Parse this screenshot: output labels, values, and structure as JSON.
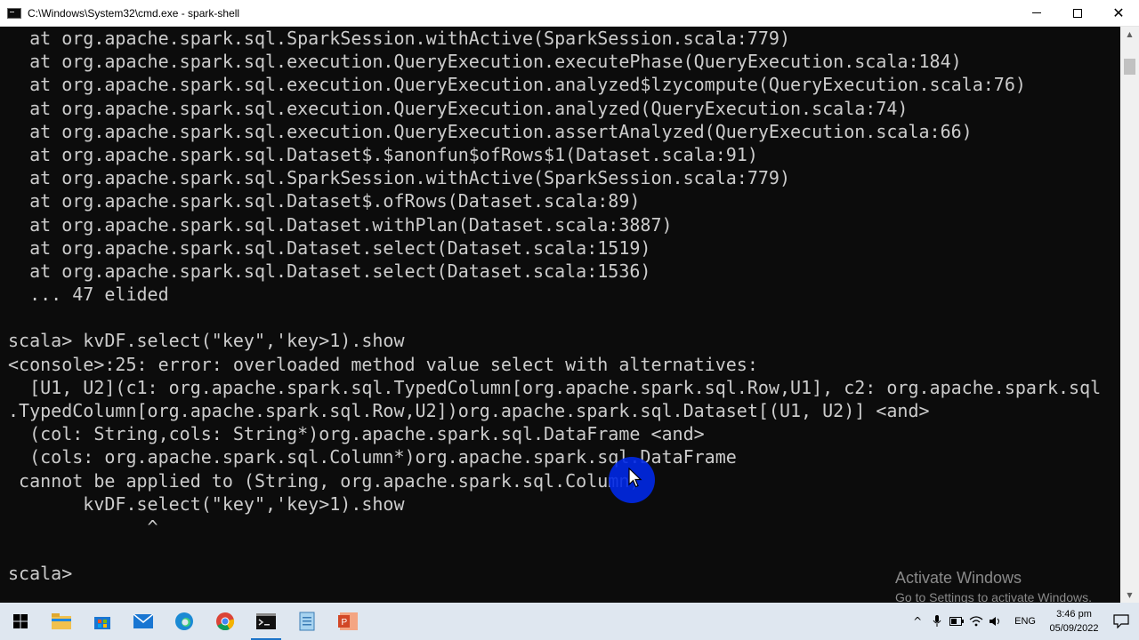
{
  "window": {
    "title": "C:\\Windows\\System32\\cmd.exe - spark-shell",
    "minimize_label": "",
    "maximize_label": "",
    "close_label": "✕"
  },
  "console": {
    "lines": [
      "  at org.apache.spark.sql.SparkSession.withActive(SparkSession.scala:779)",
      "  at org.apache.spark.sql.execution.QueryExecution.executePhase(QueryExecution.scala:184)",
      "  at org.apache.spark.sql.execution.QueryExecution.analyzed$lzycompute(QueryExecution.scala:76)",
      "  at org.apache.spark.sql.execution.QueryExecution.analyzed(QueryExecution.scala:74)",
      "  at org.apache.spark.sql.execution.QueryExecution.assertAnalyzed(QueryExecution.scala:66)",
      "  at org.apache.spark.sql.Dataset$.$anonfun$ofRows$1(Dataset.scala:91)",
      "  at org.apache.spark.sql.SparkSession.withActive(SparkSession.scala:779)",
      "  at org.apache.spark.sql.Dataset$.ofRows(Dataset.scala:89)",
      "  at org.apache.spark.sql.Dataset.withPlan(Dataset.scala:3887)",
      "  at org.apache.spark.sql.Dataset.select(Dataset.scala:1519)",
      "  at org.apache.spark.sql.Dataset.select(Dataset.scala:1536)",
      "  ... 47 elided",
      "",
      "scala> kvDF.select(\"key\",'key>1).show",
      "<console>:25: error: overloaded method value select with alternatives:",
      "  [U1, U2](c1: org.apache.spark.sql.TypedColumn[org.apache.spark.sql.Row,U1], c2: org.apache.spark.sql",
      ".TypedColumn[org.apache.spark.sql.Row,U2])org.apache.spark.sql.Dataset[(U1, U2)] <and>",
      "  (col: String,cols: String*)org.apache.spark.sql.DataFrame <and>",
      "  (cols: org.apache.spark.sql.Column*)org.apache.spark.sql.DataFrame",
      " cannot be applied to (String, org.apache.spark.sql.Column)",
      "       kvDF.select(\"key\",'key>1).show",
      "             ^",
      "",
      "scala>"
    ]
  },
  "watermark": {
    "title": "Activate Windows",
    "subtitle": "Go to Settings to activate Windows."
  },
  "taskbar": {
    "items": [
      {
        "icon": "windows-start-icon"
      },
      {
        "icon": "file-explorer-icon"
      },
      {
        "icon": "microsoft-store-icon"
      },
      {
        "icon": "mail-icon"
      },
      {
        "icon": "edge-icon"
      },
      {
        "icon": "chrome-icon"
      },
      {
        "icon": "cmd-icon"
      },
      {
        "icon": "notepad-icon"
      },
      {
        "icon": "powerpoint-icon"
      }
    ],
    "tray": {
      "language": "ENG",
      "time": "3:46 pm",
      "date": "05/09/2022"
    }
  }
}
